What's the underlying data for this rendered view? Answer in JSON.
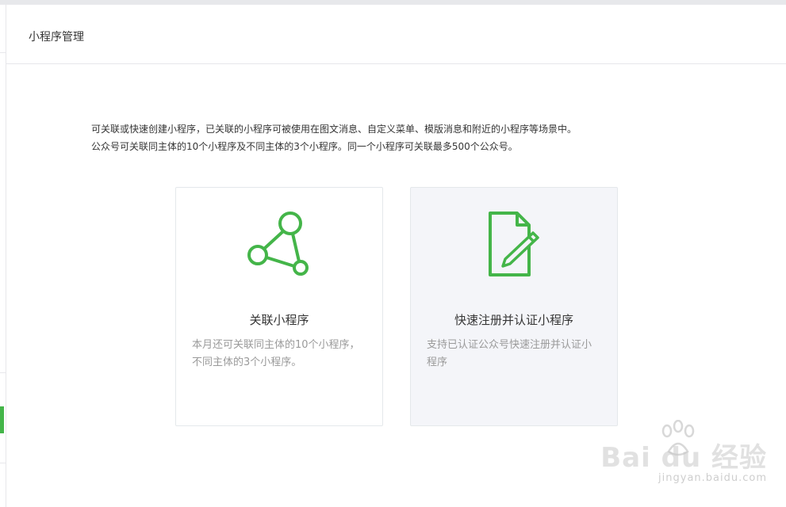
{
  "header": {
    "title": "小程序管理"
  },
  "intro": {
    "line1": "可关联或快速创建小程序，已关联的小程序可被使用在图文消息、自定义菜单、模版消息和附近的小程序等场景中。",
    "line2": "公众号可关联同主体的10个小程序及不同主体的3个小程序。同一个小程序可关联最多500个公众号。"
  },
  "cards": [
    {
      "icon": "link-nodes-icon",
      "title": "关联小程序",
      "desc": "本月还可关联同主体的10个小程序，不同主体的3个小程序。"
    },
    {
      "icon": "document-edit-icon",
      "title": "快速注册并认证小程序",
      "desc": "支持已认证公众号快速注册并认证小程序"
    }
  ],
  "colors": {
    "brand_green": "#44b549",
    "text_primary": "#353535",
    "text_secondary": "#9a9a9a",
    "border": "#e4e8eb",
    "card_hover_bg": "#f4f5f9"
  },
  "watermark": {
    "logo_text": "Bai du 经验",
    "url": "jingyan.baidu.com"
  }
}
